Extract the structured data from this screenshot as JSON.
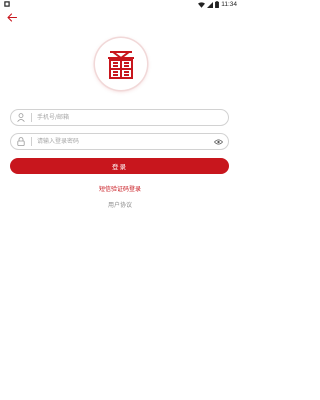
{
  "status_bar": {
    "time": "11:34",
    "icons": [
      "notification-icon",
      "wifi-icon",
      "signal-icon",
      "battery-icon"
    ]
  },
  "header": {
    "back_icon": "back-arrow-icon"
  },
  "logo": {
    "icon": "seal-logo-icon",
    "color": "#c8161d"
  },
  "form": {
    "account": {
      "icon": "user-icon",
      "placeholder": "手机号/邮箱",
      "value": ""
    },
    "password": {
      "icon": "lock-icon",
      "placeholder": "请输入登录密码",
      "value": "",
      "toggle_icon": "eye-icon"
    },
    "login_label": "登录",
    "sms_login_label": "短信验证码登录",
    "agreement_label": "用户协议"
  },
  "colors": {
    "accent": "#c8161d",
    "border": "#d2d2d2",
    "muted_text": "#888888",
    "placeholder": "#a7a7a7"
  }
}
